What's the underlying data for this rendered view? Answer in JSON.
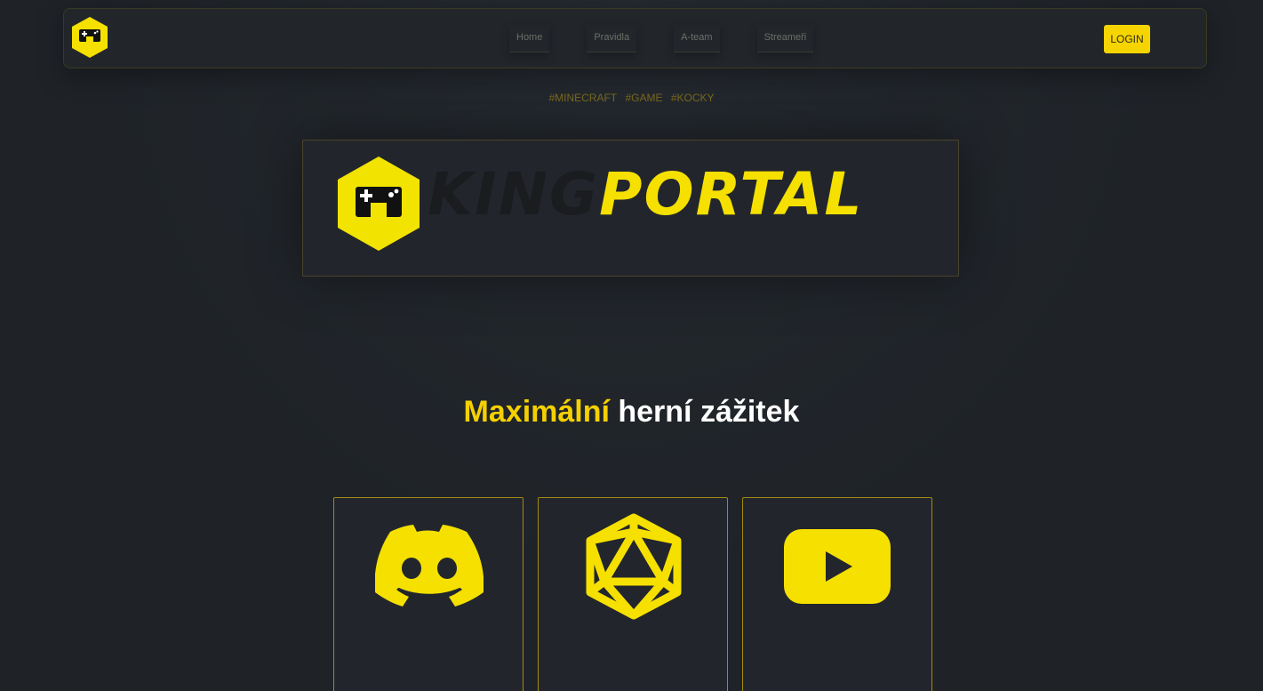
{
  "nav": {
    "links": [
      "Home",
      "Pravidla",
      "A-team",
      "Streameři"
    ],
    "login_label": "LOGIN",
    "logo_icon": "gamepad-hex-icon"
  },
  "tags": [
    "#MINECRAFT",
    "#GAME",
    "#KOCKY"
  ],
  "hero": {
    "brand_part1": "KING",
    "brand_part2": "PORTAL",
    "logo_icon": "gamepad-hex-icon"
  },
  "headline": {
    "accent": "Maximální",
    "rest": " herní zážitek"
  },
  "cards": [
    {
      "icon": "discord-icon"
    },
    {
      "icon": "icosahedron-icon"
    },
    {
      "icon": "youtube-icon"
    }
  ],
  "colors": {
    "accent": "#f5d400",
    "background": "#1f2328",
    "text": "#ffffff"
  }
}
